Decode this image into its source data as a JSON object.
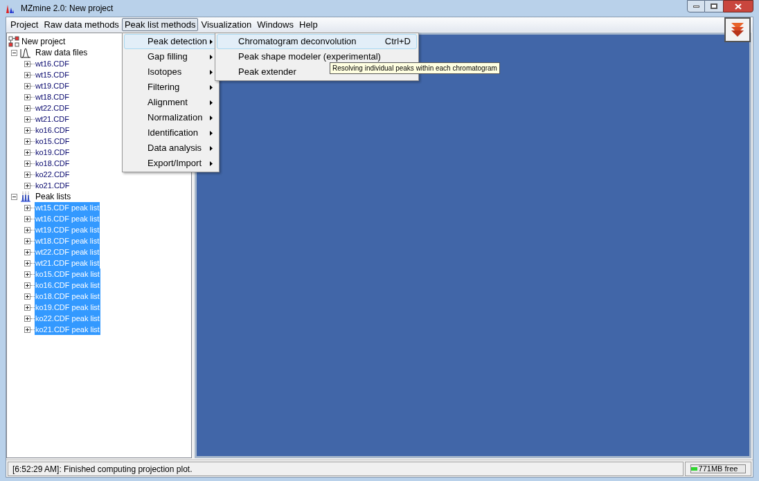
{
  "window": {
    "title": "MZmine 2.0: New project"
  },
  "menubar": [
    {
      "label": "Project",
      "selected": false
    },
    {
      "label": "Raw data methods",
      "selected": false
    },
    {
      "label": "Peak list methods",
      "selected": true
    },
    {
      "label": "Visualization",
      "selected": false
    },
    {
      "label": "Windows",
      "selected": false
    },
    {
      "label": "Help",
      "selected": false
    }
  ],
  "open_menu": [
    {
      "label": "Peak detection",
      "selected": true
    },
    {
      "label": "Gap filling",
      "selected": false
    },
    {
      "label": "Isotopes",
      "selected": false
    },
    {
      "label": "Filtering",
      "selected": false
    },
    {
      "label": "Alignment",
      "selected": false
    },
    {
      "label": "Normalization",
      "selected": false
    },
    {
      "label": "Identification",
      "selected": false
    },
    {
      "label": "Data analysis",
      "selected": false
    },
    {
      "label": "Export/Import",
      "selected": false
    }
  ],
  "submenu": [
    {
      "label": "Chromatogram deconvolution",
      "shortcut": "Ctrl+D",
      "selected": true
    },
    {
      "label": "Peak shape modeler (experimental)",
      "selected": false
    },
    {
      "label": "Peak extender",
      "selected": false
    }
  ],
  "tooltip": "Resolving individual peaks within each chromatogram",
  "tree": {
    "label": "New project",
    "children": [
      {
        "label": "Raw data files",
        "kind": "raw",
        "expanded": true,
        "children": [
          {
            "label": "wt16.CDF",
            "expanded": false,
            "selected": false
          },
          {
            "label": "wt15.CDF",
            "expanded": false,
            "selected": false
          },
          {
            "label": "wt19.CDF",
            "expanded": false,
            "selected": false
          },
          {
            "label": "wt18.CDF",
            "expanded": false,
            "selected": false
          },
          {
            "label": "wt22.CDF",
            "expanded": false,
            "selected": false
          },
          {
            "label": "wt21.CDF",
            "expanded": false,
            "selected": false
          },
          {
            "label": "ko16.CDF",
            "expanded": false,
            "selected": false
          },
          {
            "label": "ko15.CDF",
            "expanded": false,
            "selected": false
          },
          {
            "label": "ko19.CDF",
            "expanded": false,
            "selected": false
          },
          {
            "label": "ko18.CDF",
            "expanded": false,
            "selected": false
          },
          {
            "label": "ko22.CDF",
            "expanded": false,
            "selected": false
          },
          {
            "label": "ko21.CDF",
            "expanded": false,
            "selected": false
          }
        ]
      },
      {
        "label": "Peak lists",
        "kind": "peaks",
        "expanded": true,
        "children": [
          {
            "label": "wt15.CDF peak list",
            "expanded": false,
            "selected": true
          },
          {
            "label": "wt16.CDF peak list",
            "expanded": false,
            "selected": true
          },
          {
            "label": "wt19.CDF peak list",
            "expanded": false,
            "selected": true
          },
          {
            "label": "wt18.CDF peak list",
            "expanded": false,
            "selected": true
          },
          {
            "label": "wt22.CDF peak list",
            "expanded": false,
            "selected": true
          },
          {
            "label": "wt21.CDF peak list",
            "expanded": false,
            "selected": true
          },
          {
            "label": "ko15.CDF peak list",
            "expanded": false,
            "selected": true
          },
          {
            "label": "ko16.CDF peak list",
            "expanded": false,
            "selected": true
          },
          {
            "label": "ko18.CDF peak list",
            "expanded": false,
            "selected": true
          },
          {
            "label": "ko19.CDF peak list",
            "expanded": false,
            "selected": true
          },
          {
            "label": "ko22.CDF peak list",
            "expanded": false,
            "selected": true
          },
          {
            "label": "ko21.CDF peak list",
            "expanded": false,
            "selected": true
          }
        ]
      }
    ]
  },
  "status_bar": {
    "message": "[6:52:29 AM]: Finished computing projection plot.",
    "memory": {
      "label": "771MB free",
      "level": 0.12
    }
  }
}
